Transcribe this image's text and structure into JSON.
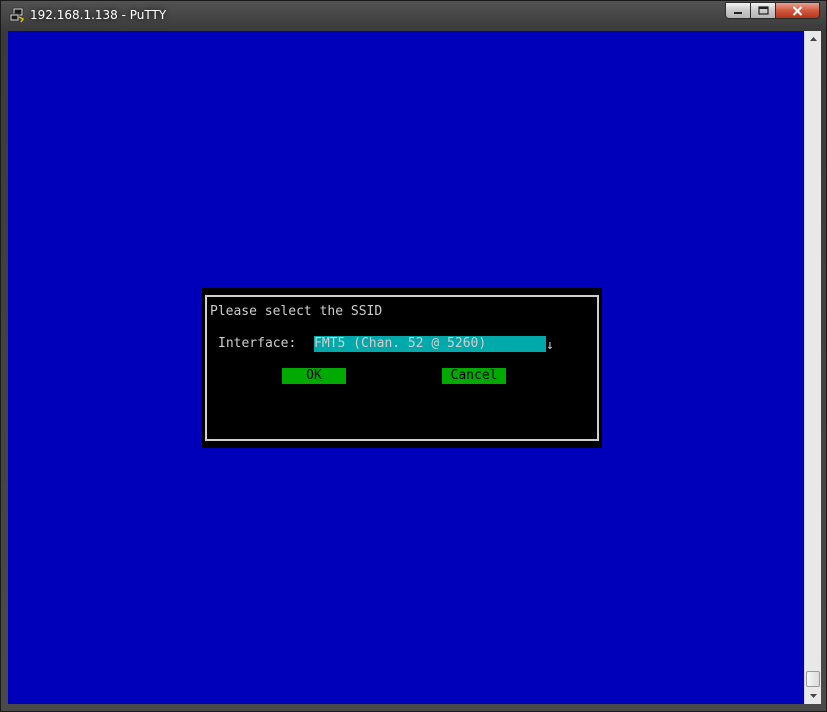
{
  "window": {
    "title": "192.168.1.138 - PuTTY",
    "controls": {
      "minimize_icon": "minimize-icon",
      "maximize_icon": "maximize-icon",
      "close_icon": "close-icon"
    }
  },
  "terminal": {
    "background": "#0000bb",
    "dialog": {
      "title": "Please select the SSID",
      "interface_label": "Interface:",
      "interface_value": "FMT5 (Chan. 52 @ 5260)",
      "dropdown_arrow": "↓",
      "ok_label": "OK",
      "cancel_label": "Cancel",
      "highlight_color": "#00aaaa",
      "button_color": "#00aa00"
    }
  },
  "scrollbar": {
    "up_icon": "arrow-up-icon",
    "down_icon": "arrow-down-icon"
  }
}
